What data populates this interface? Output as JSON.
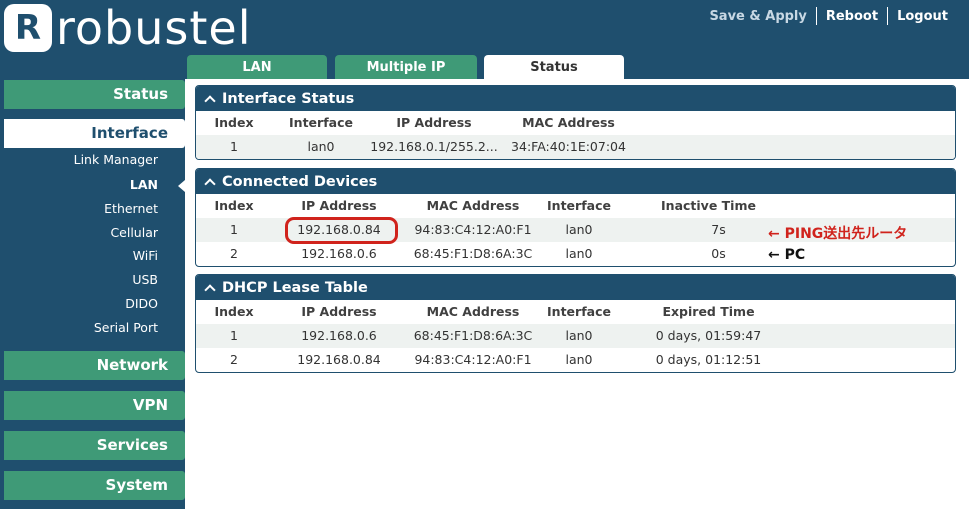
{
  "header": {
    "logo_mark": "R",
    "logo_text": "robustel",
    "links": [
      "Save & Apply",
      "Reboot",
      "Logout"
    ]
  },
  "tabs": [
    {
      "label": "LAN"
    },
    {
      "label": "Multiple IP"
    },
    {
      "label": "Status"
    }
  ],
  "sidebar": {
    "sections": [
      "Status",
      "Interface",
      "Network",
      "VPN",
      "Services",
      "System"
    ],
    "interface_items": [
      "Link Manager",
      "LAN",
      "Ethernet",
      "Cellular",
      "WiFi",
      "USB",
      "DIDO",
      "Serial Port"
    ]
  },
  "interface_status": {
    "title": "Interface Status",
    "columns": [
      "Index",
      "Interface",
      "IP Address",
      "MAC Address"
    ],
    "rows": [
      [
        "1",
        "lan0",
        "192.168.0.1/255.2...",
        "34:FA:40:1E:07:04"
      ]
    ]
  },
  "connected_devices": {
    "title": "Connected Devices",
    "columns": [
      "Index",
      "IP Address",
      "MAC Address",
      "Interface",
      "Inactive Time"
    ],
    "rows": [
      [
        "1",
        "192.168.0.84",
        "94:83:C4:12:A0:F1",
        "lan0",
        "7s"
      ],
      [
        "2",
        "192.168.0.6",
        "68:45:F1:D8:6A:3C",
        "lan0",
        "0s"
      ]
    ]
  },
  "dhcp_lease": {
    "title": "DHCP Lease Table",
    "columns": [
      "Index",
      "IP Address",
      "MAC Address",
      "Interface",
      "Expired Time"
    ],
    "rows": [
      [
        "1",
        "192.168.0.6",
        "68:45:F1:D8:6A:3C",
        "lan0",
        "0 days, 01:59:47"
      ],
      [
        "2",
        "192.168.0.84",
        "94:83:C4:12:A0:F1",
        "lan0",
        "0 days, 01:12:51"
      ]
    ]
  },
  "annotations": {
    "ping_target": "← PING送出先ルータ",
    "pc": "← PC"
  },
  "colors": {
    "navy": "#1f4f6e",
    "green": "#3f9a77",
    "highlight_red": "#d0231c"
  }
}
